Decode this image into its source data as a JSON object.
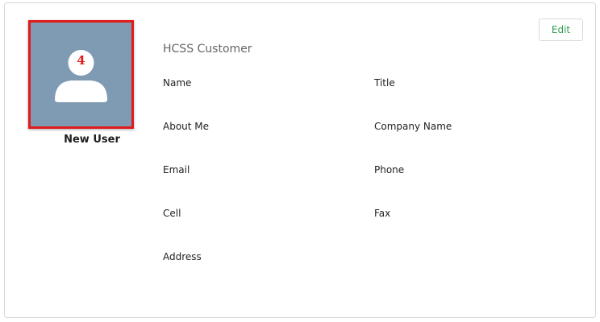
{
  "profile": {
    "badge_number": "4",
    "user_name": "New User",
    "organization": "HCSS Customer",
    "edit_label": "Edit"
  },
  "fields": {
    "name": "Name",
    "title": "Title",
    "about_me": "About Me",
    "company_name": "Company Name",
    "email": "Email",
    "phone": "Phone",
    "cell": "Cell",
    "fax": "Fax",
    "address": "Address"
  },
  "colors": {
    "avatar_bg": "#7f9bb3",
    "highlight_border": "#e01b1b",
    "edit_text": "#2e9e55"
  },
  "icons": {
    "avatar": "user-silhouette-icon"
  }
}
